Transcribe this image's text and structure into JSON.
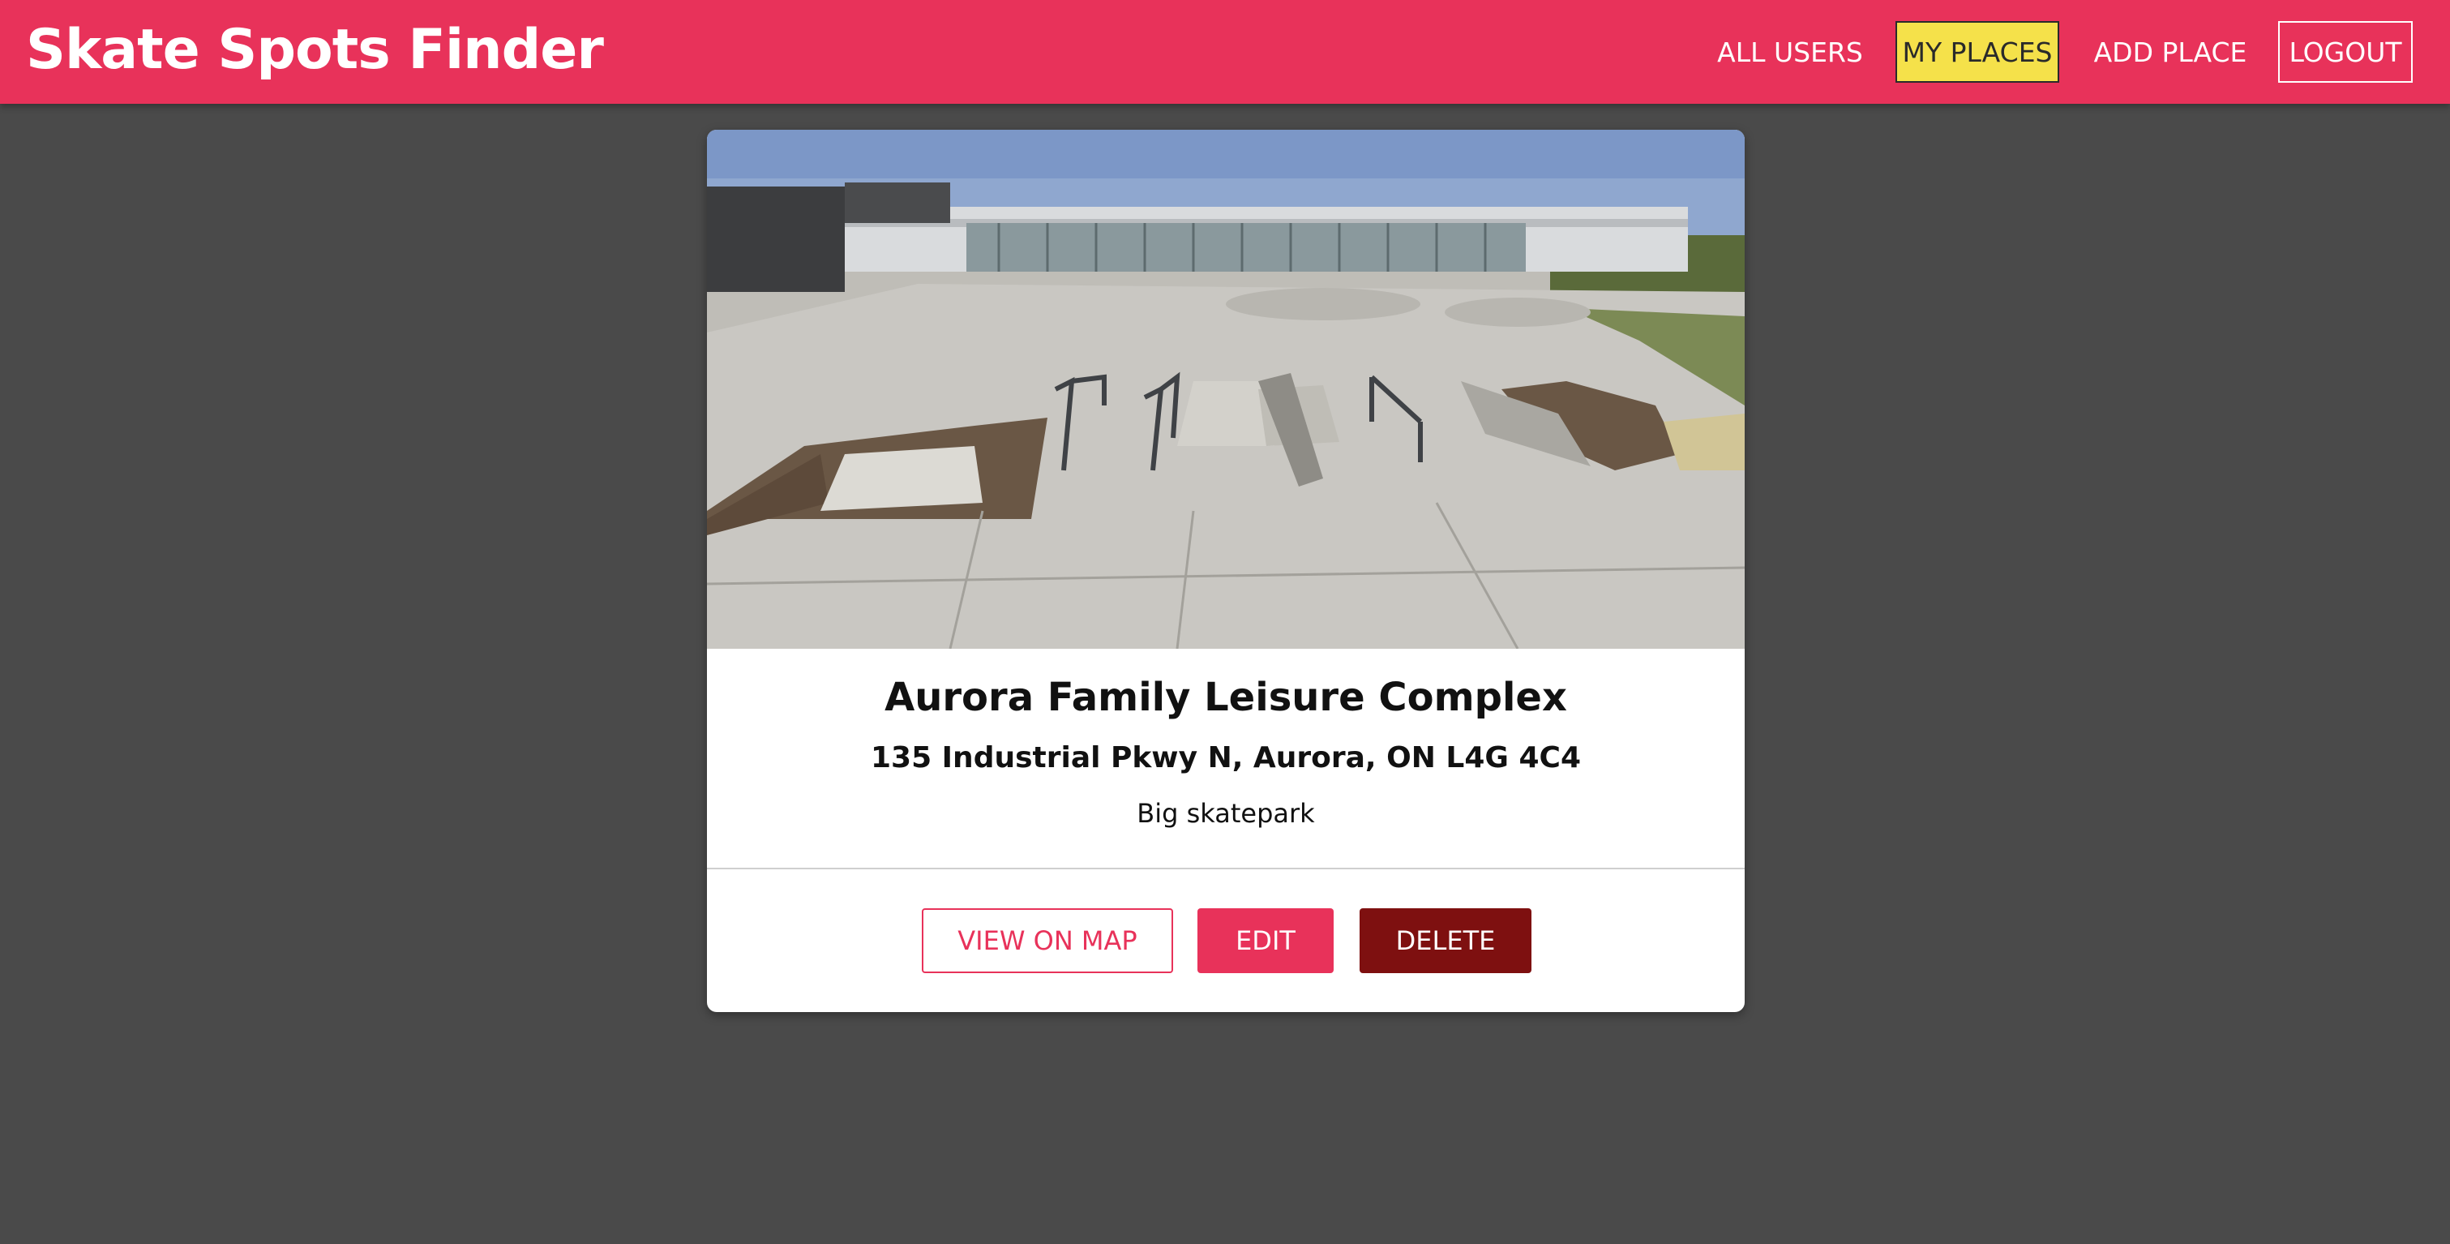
{
  "header": {
    "brand": "Skate Spots Finder",
    "nav": {
      "all_users": "ALL USERS",
      "my_places": "MY PLACES",
      "add_place": "ADD PLACE",
      "logout": "LOGOUT"
    }
  },
  "place": {
    "title": "Aurora Family Leisure Complex",
    "address": "135 Industrial Pkwy N, Aurora, ON L4G 4C4",
    "description": "Big skatepark",
    "actions": {
      "view_on_map": "VIEW ON MAP",
      "edit": "EDIT",
      "delete": "DELETE"
    }
  },
  "colors": {
    "brand_primary": "#e8325a",
    "nav_active_bg": "#f5e14a",
    "delete_bg": "#7e1010",
    "page_bg": "#4a4a4a"
  }
}
